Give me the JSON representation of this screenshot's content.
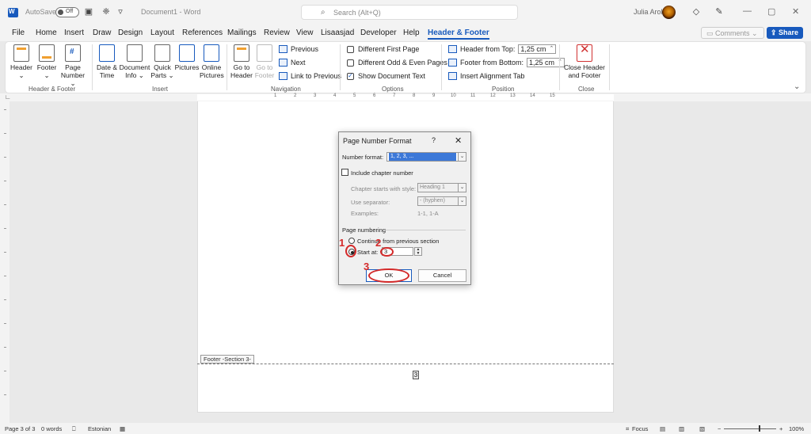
{
  "titlebar": {
    "autosave_label": "AutoSave",
    "autosave_state": "Off",
    "doc_title": "Document1  -  Word",
    "search_placeholder": "Search (Alt+Q)",
    "user_name": "Julia Arold",
    "minimize": "—",
    "restore": "▢",
    "close": "✕"
  },
  "tabs": [
    "File",
    "Home",
    "Insert",
    "Draw",
    "Design",
    "Layout",
    "References",
    "Mailings",
    "Review",
    "View",
    "Lisaasjad",
    "Developer",
    "Help",
    "Header & Footer"
  ],
  "active_tab": "Header & Footer",
  "comments_label": "Comments",
  "share_label": "Share",
  "ribbon": {
    "header_label": "Header",
    "footer_label": "Footer",
    "page_number_label": "Page",
    "page_number_label2": "Number",
    "date_time_label": "Date &",
    "date_time_label2": "Time",
    "doc_info_label": "Document",
    "doc_info_label2": "Info",
    "quick_parts_label": "Quick",
    "quick_parts_label2": "Parts",
    "pictures_label": "Pictures",
    "online_pictures_label": "Online",
    "online_pictures_label2": "Pictures",
    "go_to_header_label": "Go to",
    "go_to_header_label2": "Header",
    "go_to_footer_label": "Go to",
    "go_to_footer_label2": "Footer",
    "previous_label": "Previous",
    "next_label": "Next",
    "link_previous_label": "Link to Previous",
    "diff_first_label": "Different First Page",
    "diff_odd_even_label": "Different Odd & Even Pages",
    "show_doc_text_label": "Show Document Text",
    "header_from_top_label": "Header from Top:",
    "header_from_top_value": "1,25 cm",
    "footer_from_bottom_label": "Footer from Bottom:",
    "footer_from_bottom_value": "1,25 cm",
    "insert_align_tab_label": "Insert Alignment Tab",
    "close_hf_label": "Close Header",
    "close_hf_label2": "and Footer",
    "groups": {
      "hf": "Header & Footer",
      "insert": "Insert",
      "navigation": "Navigation",
      "options": "Options",
      "position": "Position",
      "close": "Close"
    }
  },
  "ruler_numbers": [
    "1",
    "2",
    "3",
    "4",
    "5",
    "6",
    "7",
    "8",
    "9",
    "10",
    "11",
    "12",
    "13",
    "14",
    "15"
  ],
  "document": {
    "footer_tag": "Footer -Section 3-",
    "footer_page_number": "3"
  },
  "dialog": {
    "title": "Page Number Format",
    "help": "?",
    "close": "✕",
    "number_format_label": "Number format:",
    "number_format_value": "1, 2, 3, ...",
    "include_chapter_label": "Include chapter number",
    "chapter_starts_label": "Chapter starts with style:",
    "chapter_starts_value": "Heading 1",
    "use_separator_label": "Use separator:",
    "use_separator_value": "-  (hyphen)",
    "examples_label": "Examples:",
    "examples_value": "1-1, 1-A",
    "page_numbering_label": "Page numbering",
    "continue_label": "Continue from previous section",
    "start_at_label": "Start at:",
    "start_at_value": "3",
    "ok_label": "OK",
    "cancel_label": "Cancel"
  },
  "annotations": [
    "1",
    "2",
    "3"
  ],
  "annotation_color": "#d42a2a",
  "statusbar": {
    "page_info": "Page 3 of 3",
    "words": "0 words",
    "language": "Estonian",
    "focus": "Focus",
    "zoom": "100%"
  },
  "colors": {
    "accent": "#185abd"
  }
}
